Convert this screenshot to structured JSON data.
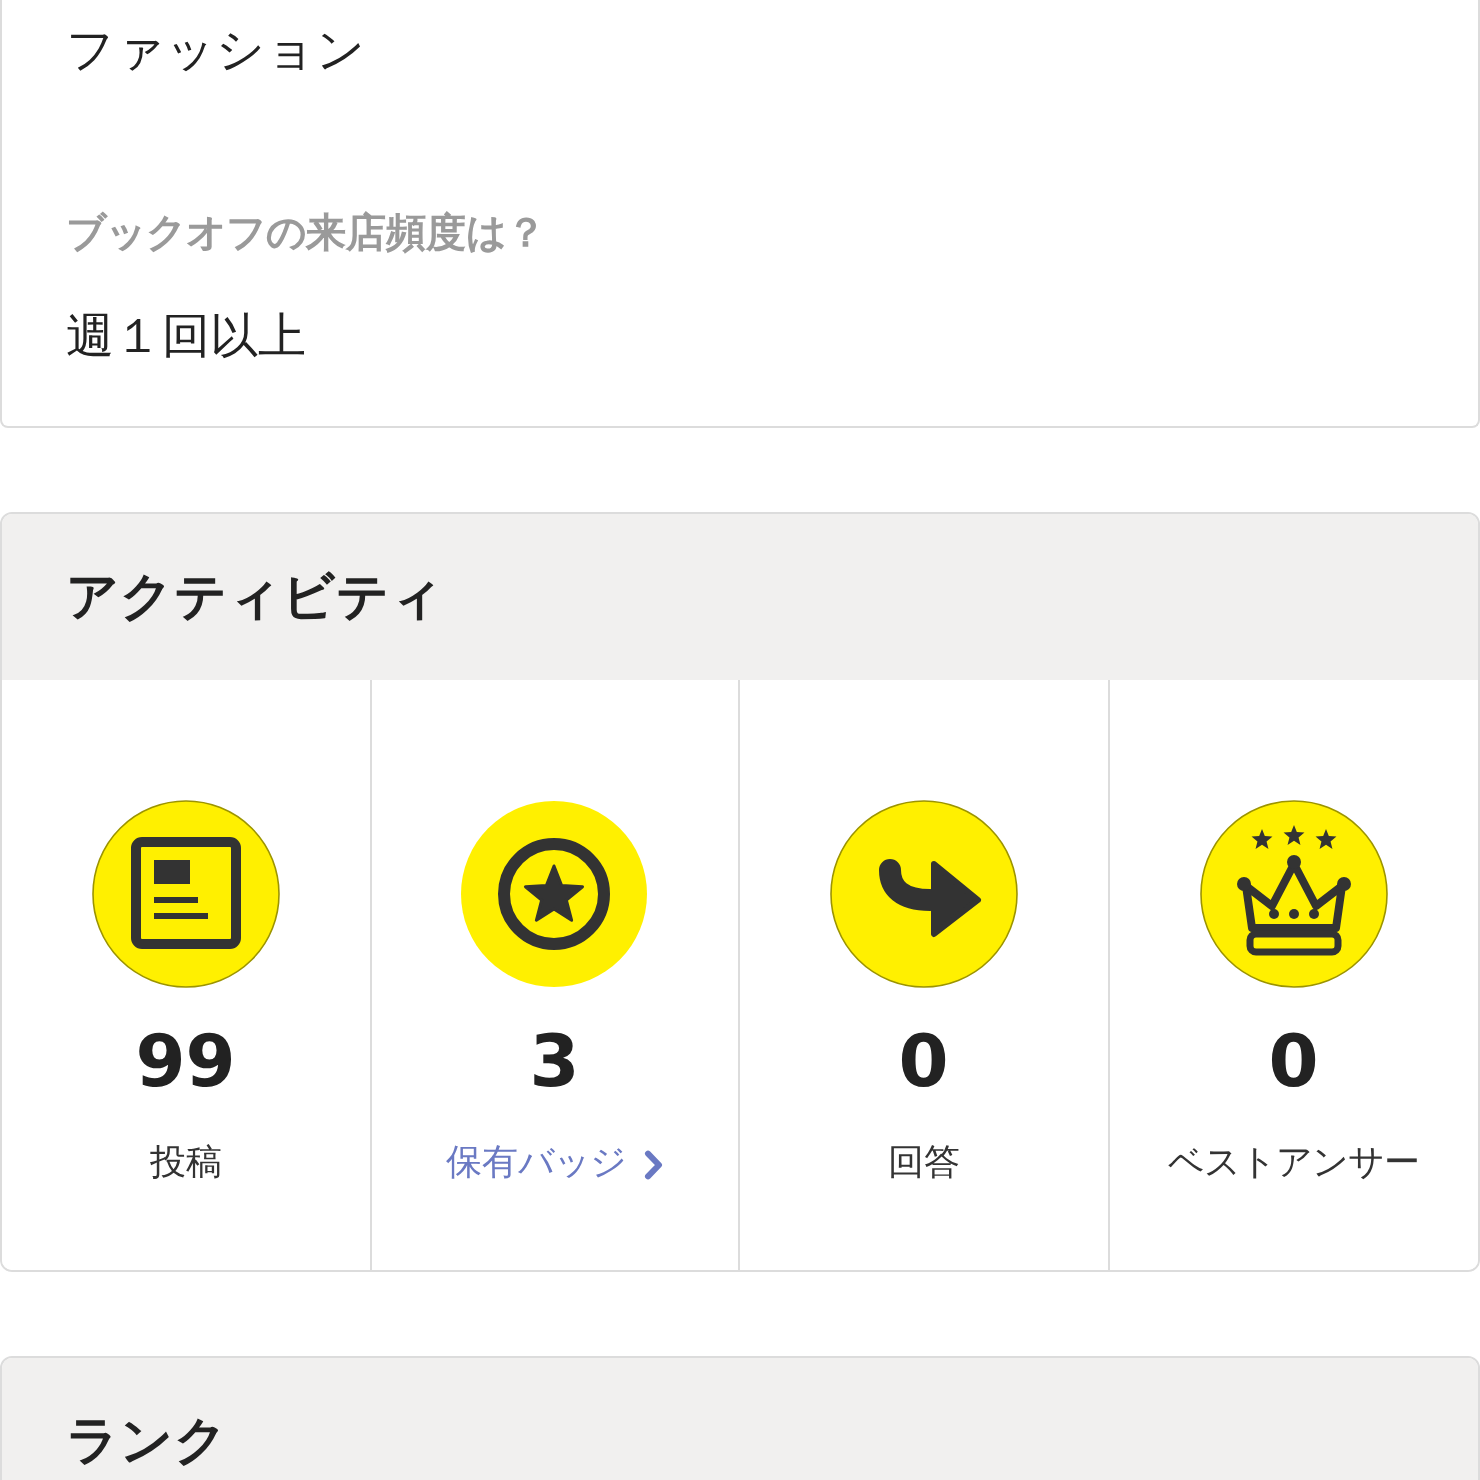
{
  "profile_answers": [
    {
      "kind": "answer",
      "text": "ファッション"
    },
    {
      "kind": "question",
      "text": "ブックオフの来店頻度は？"
    },
    {
      "kind": "answer",
      "text": "週１回以上"
    }
  ],
  "activity": {
    "title": "アクティビティ",
    "stats": [
      {
        "kind": "text",
        "count": "99",
        "label": "投稿"
      },
      {
        "kind": "link",
        "count": "3",
        "label": "保有バッジ"
      },
      {
        "kind": "text",
        "count": "0",
        "label": "回答"
      },
      {
        "kind": "text",
        "count": "0",
        "label": "ベストアンサー"
      }
    ]
  },
  "rank": {
    "title": "ランク"
  }
}
